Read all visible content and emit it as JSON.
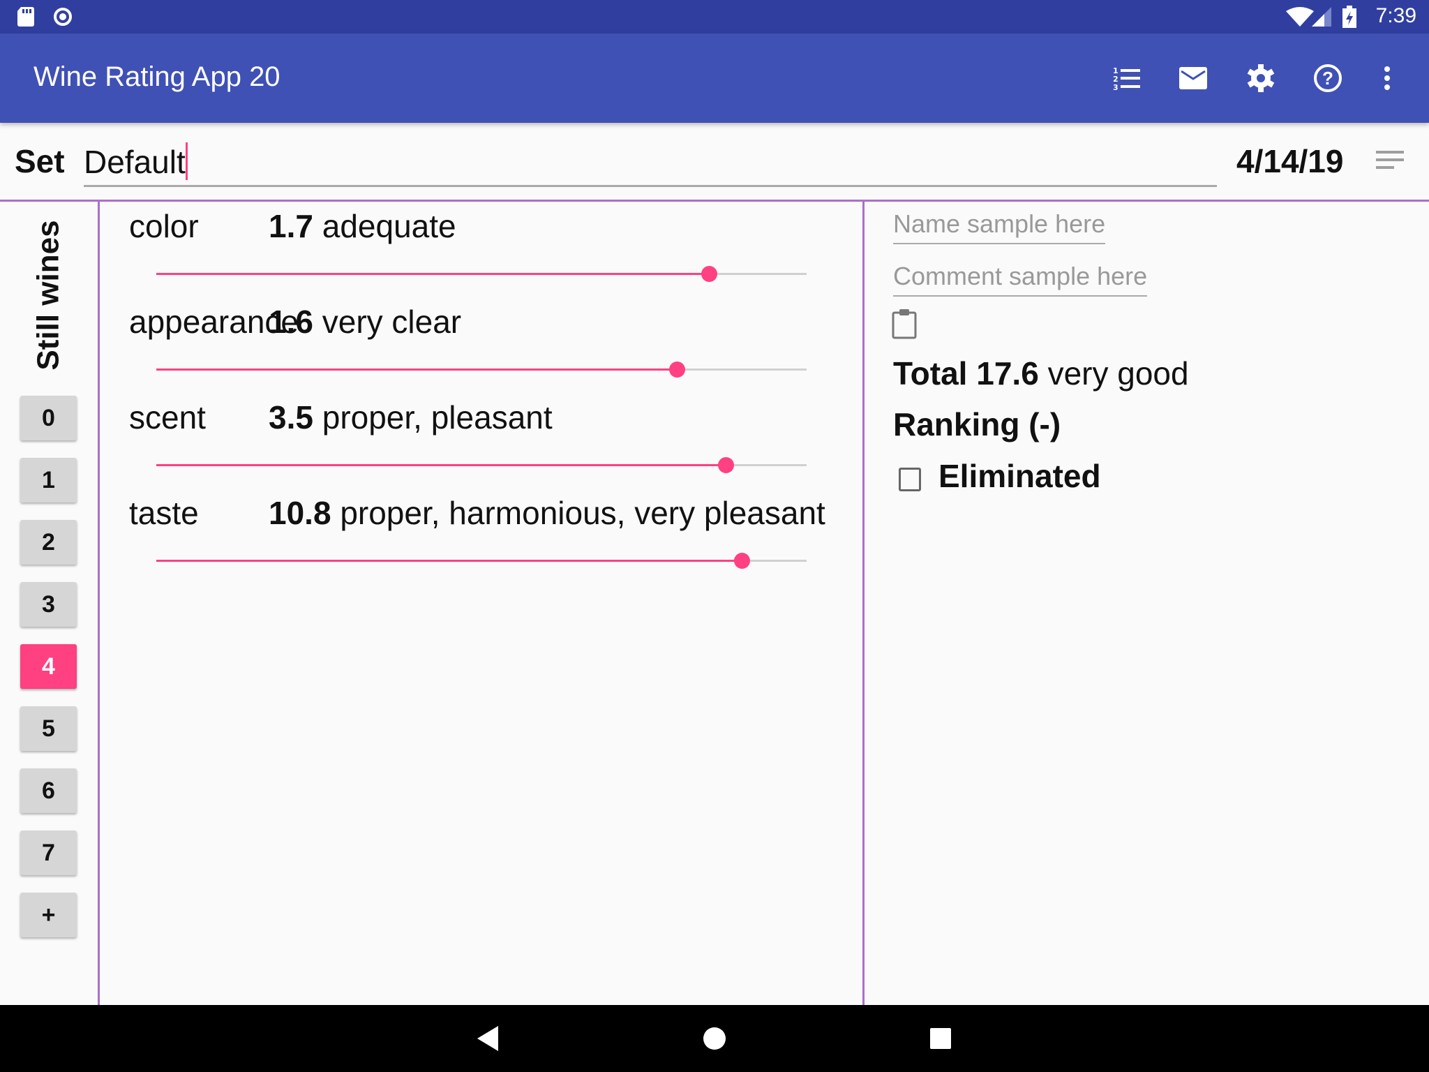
{
  "status_bar": {
    "time": "7:39",
    "icons": [
      "sd-card-icon",
      "sync-icon",
      "wifi-icon",
      "signal-icon",
      "battery-charging-icon"
    ]
  },
  "app_bar": {
    "title": "Wine Rating App 20",
    "actions": [
      "ranking-list-icon",
      "mail-icon",
      "settings-gear-icon",
      "help-icon",
      "more-vert-icon"
    ]
  },
  "set_row": {
    "label": "Set",
    "value": "Default",
    "date": "4/14/19"
  },
  "sidebar": {
    "title": "Still wines",
    "wines": [
      "0",
      "1",
      "2",
      "3",
      "4",
      "5",
      "6",
      "7",
      "+"
    ],
    "selected": "4"
  },
  "criteria": [
    {
      "label": "color",
      "value": "1.7",
      "description": "adequate",
      "max": 2
    },
    {
      "label": "appearance",
      "value": "1.6",
      "description": "very clear",
      "max": 2
    },
    {
      "label": "scent",
      "value": "3.5",
      "description": "proper, pleasant",
      "max": 4
    },
    {
      "label": "taste",
      "value": "10.8",
      "description": "proper, harmonious, very pleasant",
      "max": 12
    }
  ],
  "details": {
    "name_placeholder": "Name sample here",
    "comment_placeholder": "Comment sample here",
    "total_label": "Total",
    "total_value": "17.6",
    "total_description": "very good",
    "ranking": "Ranking (-)",
    "eliminated_label": "Eliminated",
    "eliminated": false
  },
  "colors": {
    "primary": "#3f51b5",
    "primary_dark": "#303f9f",
    "accent": "#ff4081",
    "divider": "#ab6fcc"
  }
}
